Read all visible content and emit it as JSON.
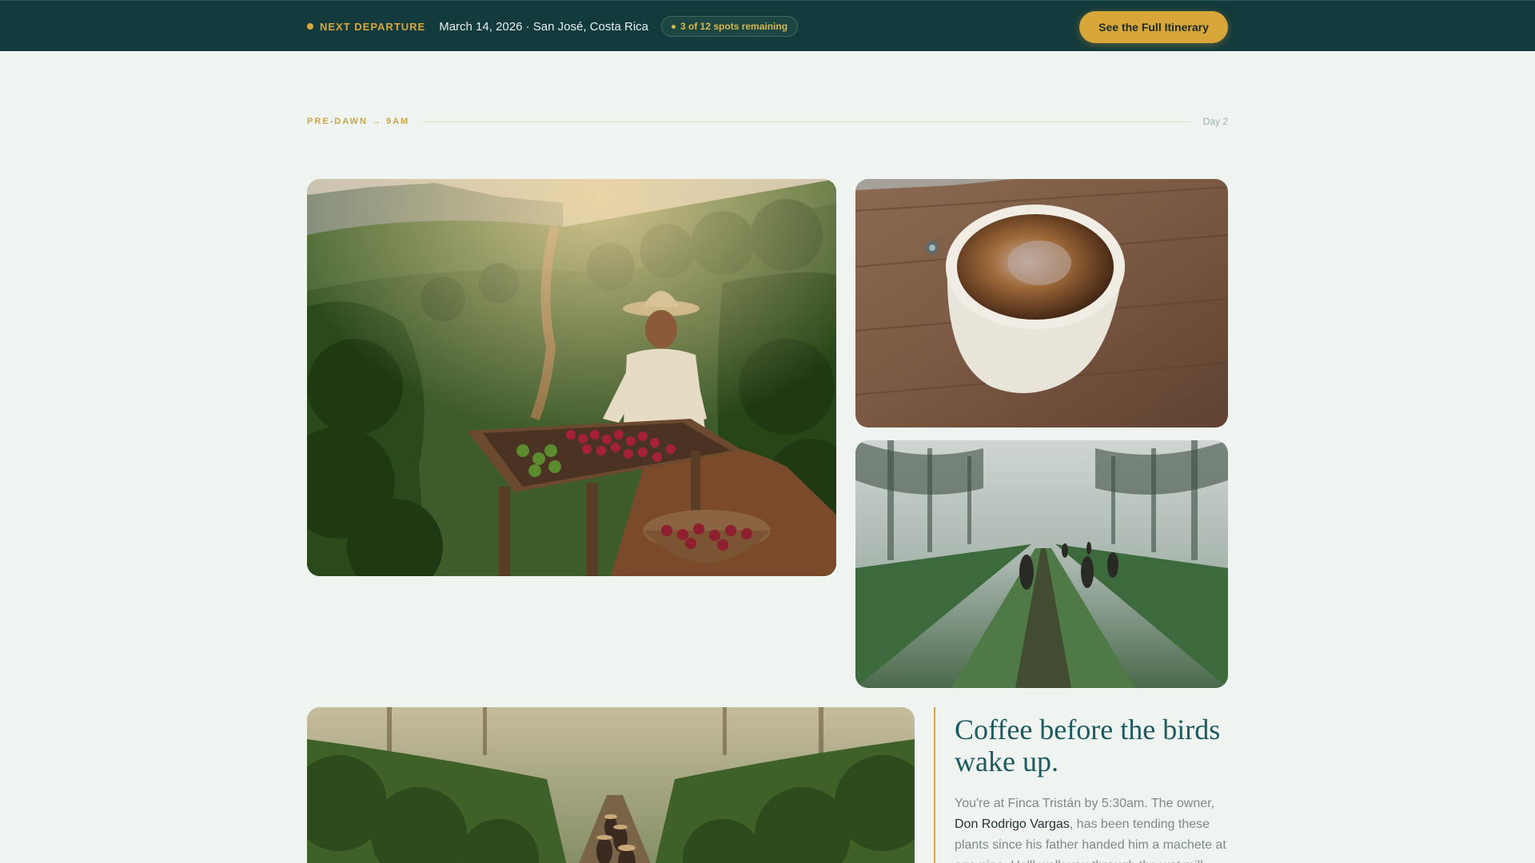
{
  "topbar": {
    "departure_label": "NEXT DEPARTURE",
    "departure_info": "March 14, 2026 · San José, Costa Rica",
    "spots": "3 of 12 spots remaining",
    "cta_label": "See the Full Itinerary"
  },
  "section": {
    "time_label": "PRE-DAWN → 9AM",
    "day_label": "Day 2"
  },
  "photos": {
    "main_icon": "coffee-farmer-photo",
    "cup_icon": "coffee-cup-photo",
    "mist_icon": "misty-plantation-photo",
    "row_icon": "plantation-row-photo"
  },
  "story": {
    "heading": "Coffee before the birds wake up.",
    "body_before": "You're at Finca Tristán by 5:30am. The owner, ",
    "host_name": "Don Rodrigo Vargas",
    "body_after": ", has been tending these plants since his father handed him a machete at age nine. He'll walk you through the wet mill"
  },
  "colors": {
    "topbar_bg": "#133a3c",
    "accent": "#d9a63a",
    "page_bg": "#eff4f1",
    "heading": "#1d5a5f"
  }
}
